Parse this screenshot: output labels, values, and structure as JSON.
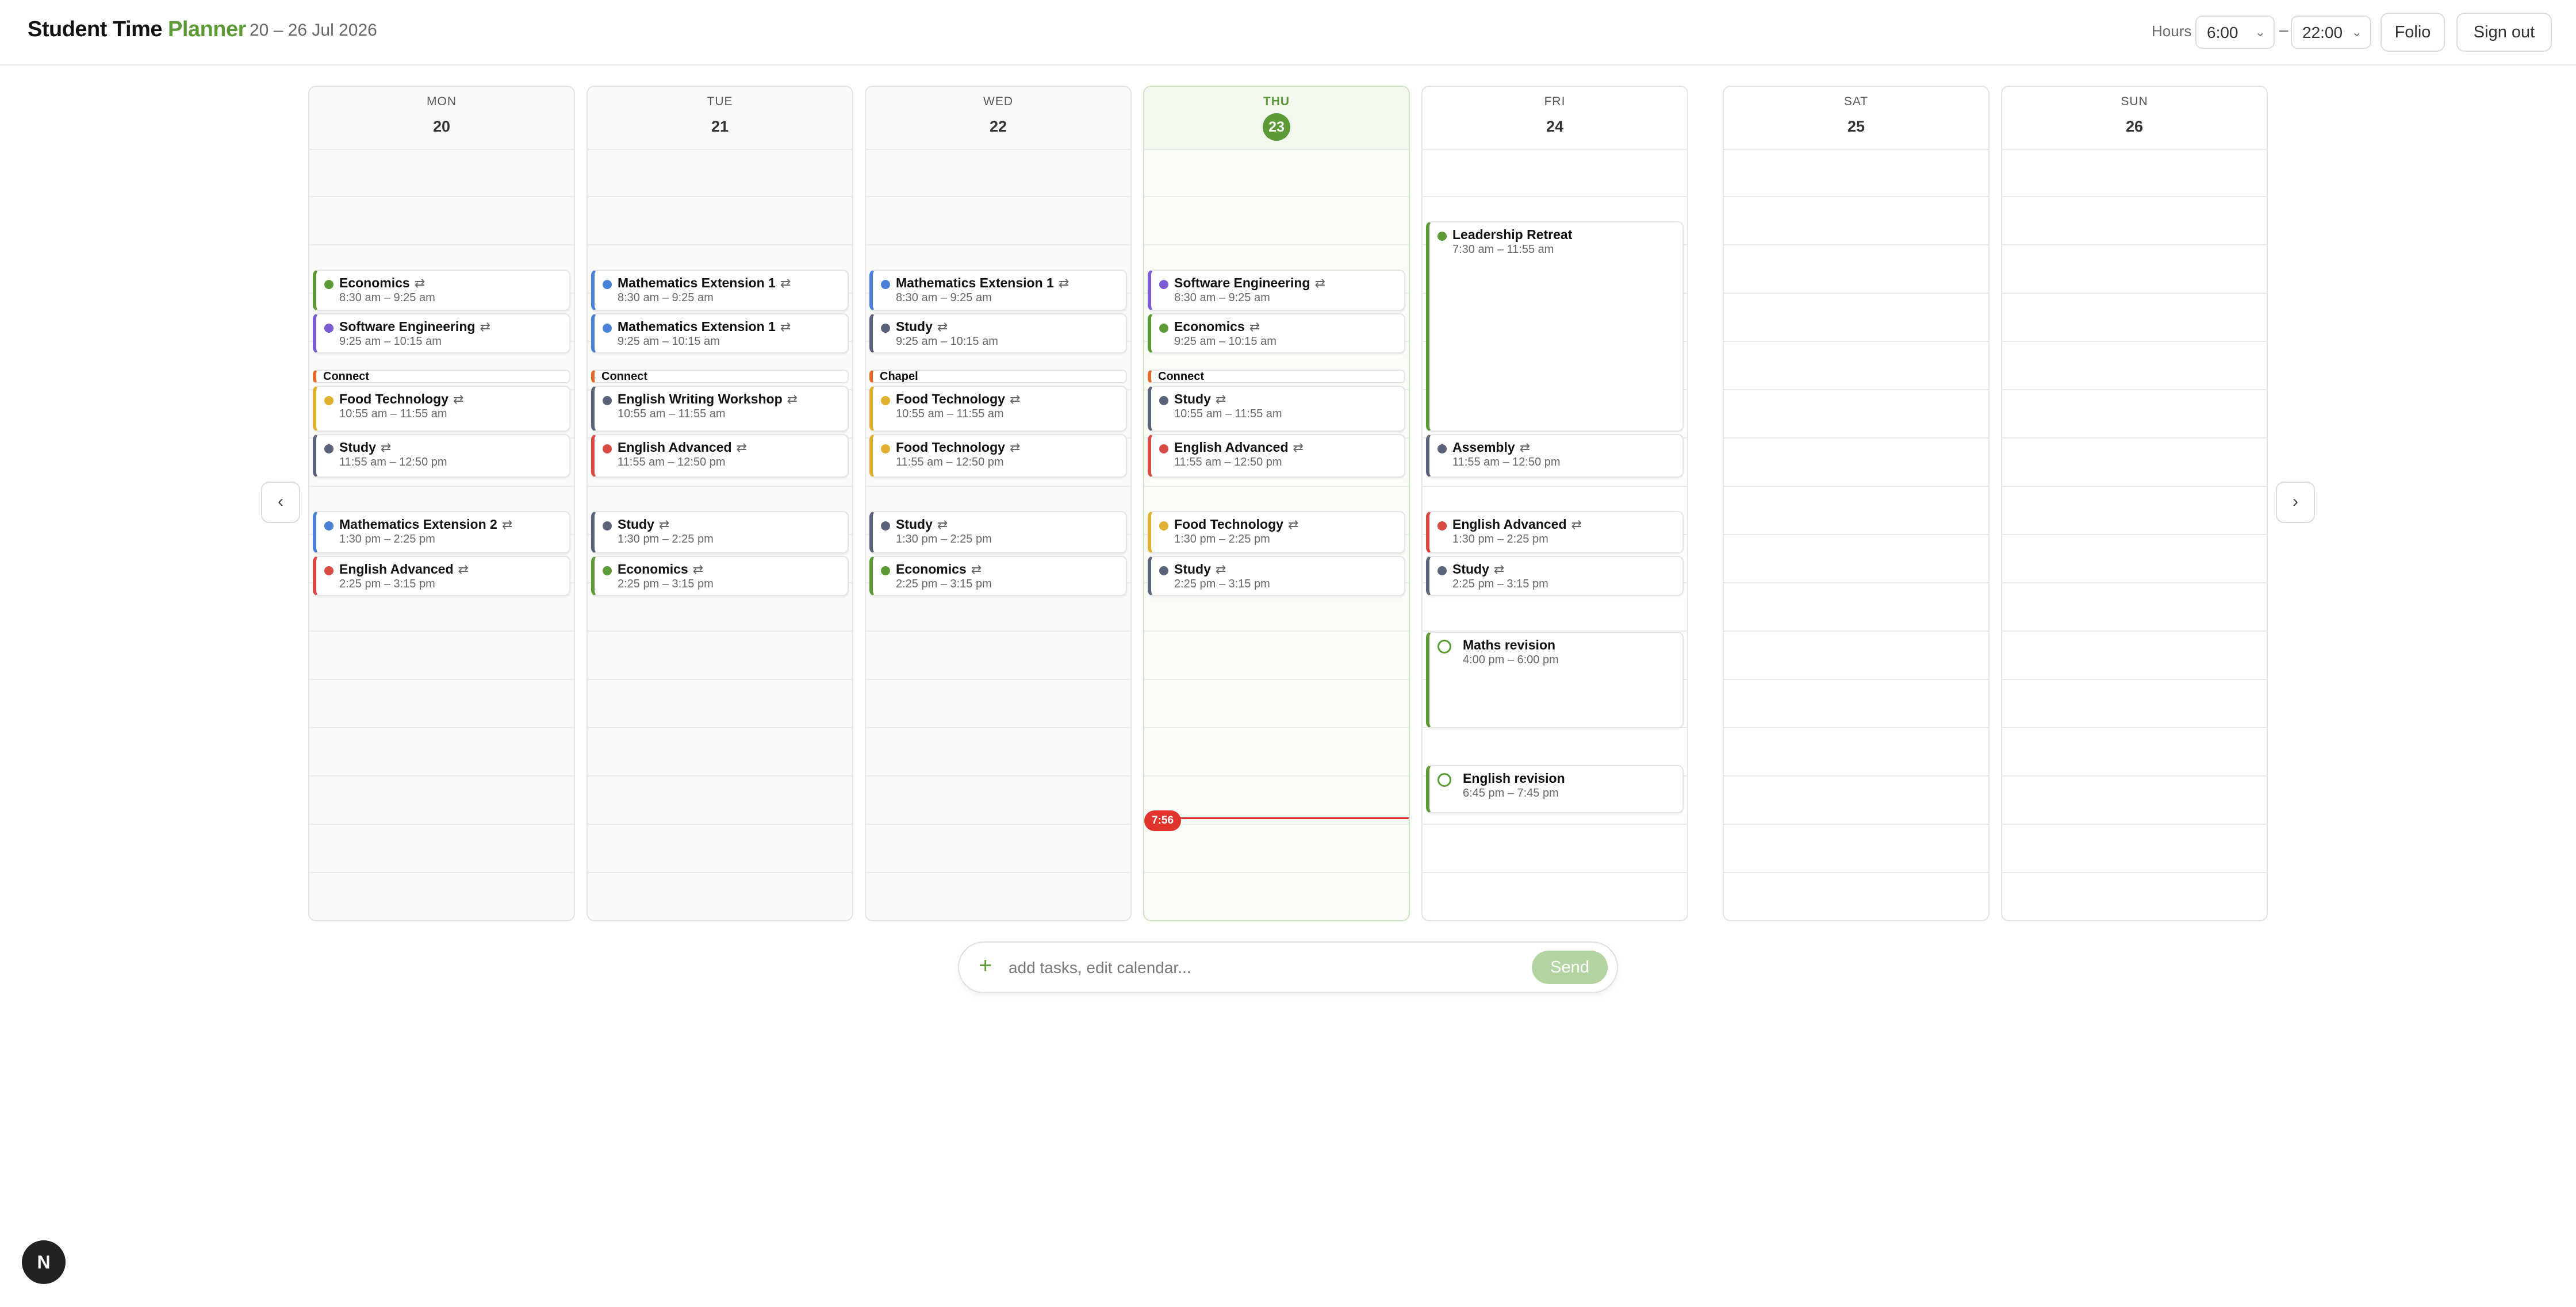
{
  "app": {
    "title_main": "Student Time ",
    "title_accent": "Planner",
    "date_range": "20 – 26 Jul 2026"
  },
  "header": {
    "hours_label": "Hours",
    "start_hour": "6:00",
    "end_hour": "22:00",
    "dash": "–",
    "folio": "Folio",
    "sign_out": "Sign out"
  },
  "nav": {
    "prev": "‹",
    "next": "›"
  },
  "colors": {
    "economics": "#5b9a35",
    "software": "#7b5bd6",
    "maths": "#4a80d8",
    "food": "#e0b030",
    "study": "#5a6478",
    "english": "#d94a44",
    "connect": "#e46a2a",
    "accent": "#5b9a35"
  },
  "repeat_icon": "⇄",
  "days": [
    {
      "name": "MON",
      "num": "20",
      "bar": "Connect",
      "events": [
        {
          "title": "Economics",
          "time": "8:30 am – 9:25 am"
        },
        {
          "title": "Software Engineering",
          "time": "9:25 am – 10:15 am"
        },
        {
          "title": "Food Technology",
          "time": "10:55 am – 11:55 am"
        },
        {
          "title": "Study",
          "time": "11:55 am – 12:50 pm"
        },
        {
          "title": "Mathematics Extension 2",
          "time": "1:30 pm – 2:25 pm"
        },
        {
          "title": "English Advanced",
          "time": "2:25 pm – 3:15 pm"
        }
      ]
    },
    {
      "name": "TUE",
      "num": "21",
      "bar": "Connect",
      "events": [
        {
          "title": "Mathematics Extension 1",
          "time": "8:30 am – 9:25 am"
        },
        {
          "title": "Mathematics Extension 1",
          "time": "9:25 am – 10:15 am"
        },
        {
          "title": "English Writing Workshop",
          "time": "10:55 am – 11:55 am"
        },
        {
          "title": "English Advanced",
          "time": "11:55 am – 12:50 pm"
        },
        {
          "title": "Study",
          "time": "1:30 pm – 2:25 pm"
        },
        {
          "title": "Economics",
          "time": "2:25 pm – 3:15 pm"
        }
      ]
    },
    {
      "name": "WED",
      "num": "22",
      "bar": "Chapel",
      "events": [
        {
          "title": "Mathematics Extension 1",
          "time": "8:30 am – 9:25 am"
        },
        {
          "title": "Study",
          "time": "9:25 am – 10:15 am"
        },
        {
          "title": "Food Technology",
          "time": "10:55 am – 11:55 am"
        },
        {
          "title": "Food Technology",
          "time": "11:55 am – 12:50 pm"
        },
        {
          "title": "Study",
          "time": "1:30 pm – 2:25 pm"
        },
        {
          "title": "Economics",
          "time": "2:25 pm – 3:15 pm"
        }
      ]
    },
    {
      "name": "THU",
      "num": "23",
      "bar": "Connect",
      "now": "7:56",
      "events": [
        {
          "title": "Software Engineering",
          "time": "8:30 am – 9:25 am"
        },
        {
          "title": "Economics",
          "time": "9:25 am – 10:15 am"
        },
        {
          "title": "Study",
          "time": "10:55 am – 11:55 am"
        },
        {
          "title": "English Advanced",
          "time": "11:55 am – 12:50 pm"
        },
        {
          "title": "Food Technology",
          "time": "1:30 pm – 2:25 pm"
        },
        {
          "title": "Study",
          "time": "2:25 pm – 3:15 pm"
        }
      ]
    },
    {
      "name": "FRI",
      "num": "24",
      "events": [
        {
          "title": "Leadership Retreat",
          "time": "7:30 am – 11:55 am"
        },
        {
          "title": "Assembly",
          "time": "11:55 am – 12:50 pm"
        },
        {
          "title": "English Advanced",
          "time": "1:30 pm – 2:25 pm"
        },
        {
          "title": "Study",
          "time": "2:25 pm – 3:15 pm"
        },
        {
          "title": "Maths revision",
          "time": "4:00 pm – 6:00 pm"
        },
        {
          "title": "English revision",
          "time": "6:45 pm – 7:45 pm"
        }
      ]
    },
    {
      "name": "SAT",
      "num": "25",
      "events": []
    },
    {
      "name": "SUN",
      "num": "26",
      "events": []
    }
  ],
  "prompt": {
    "placeholder": "add tasks, edit calendar...",
    "plus": "+",
    "send": "Send"
  },
  "badge": "N"
}
